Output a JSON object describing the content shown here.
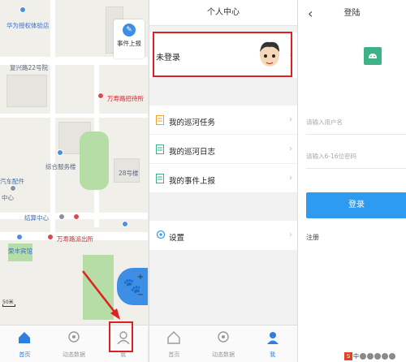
{
  "map": {
    "labels": {
      "huawei": "华为授权体验店",
      "fuxing22": "复兴路22号院",
      "wanshou_hotel": "万寿路招待所",
      "service_bldg": "综合服务楼",
      "bldg28": "28号楼",
      "auto_parts": "汽车配件",
      "center": "中心",
      "jiezheng": "结算中心",
      "police": "万寿路派出所",
      "rongfeng": "荣丰宾馆"
    },
    "report_label": "事件上报",
    "scale_label": "50米"
  },
  "tabbar": {
    "home": "首页",
    "dynamic": "动态数据",
    "me": "我"
  },
  "profile": {
    "title": "个人中心",
    "login_text": "未登录",
    "menu": [
      {
        "label": "我的巡河任务"
      },
      {
        "label": "我的巡河日志"
      },
      {
        "label": "我的事件上报"
      }
    ],
    "settings": "设置"
  },
  "login": {
    "title": "登陆",
    "username_placeholder": "请输入用户名",
    "password_placeholder": "请输入6-16位密码",
    "button": "登录",
    "register": "注册"
  },
  "ime": {
    "mode": "中"
  },
  "colors": {
    "accent": "#2d9bf0",
    "highlight": "#e02020",
    "app_logo": "#3db289"
  }
}
